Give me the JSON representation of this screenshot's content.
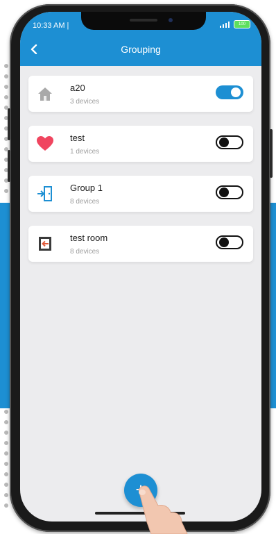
{
  "status_bar": {
    "time": "10:33 AM |",
    "battery": "100"
  },
  "header": {
    "title": "Grouping"
  },
  "groups": [
    {
      "name": "a20",
      "count": "3 devices",
      "icon": "home-icon",
      "enabled": true
    },
    {
      "name": "test",
      "count": "1 devices",
      "icon": "heart-icon",
      "enabled": false
    },
    {
      "name": "Group  1",
      "count": "8 devices",
      "icon": "door-exit-icon",
      "enabled": false
    },
    {
      "name": "test  room",
      "count": "8 devices",
      "icon": "door-enter-icon",
      "enabled": false
    }
  ],
  "fab": {
    "label": "+"
  },
  "colors": {
    "accent": "#1d8fd3",
    "screen_bg": "#ececee",
    "heart": "#f0455f"
  }
}
